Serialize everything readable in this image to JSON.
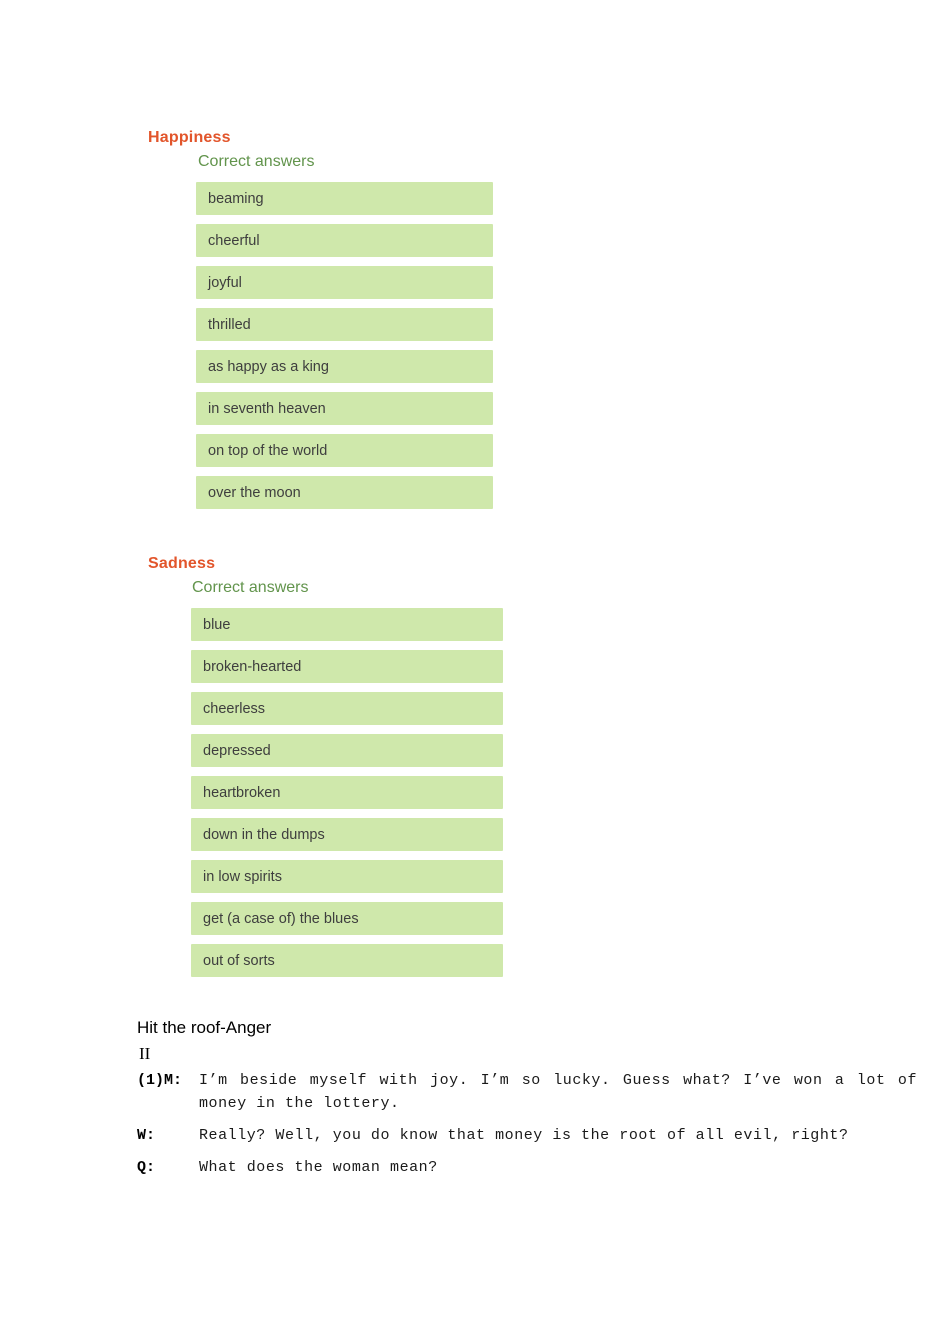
{
  "groups": [
    {
      "title": "Happiness",
      "correct_label": "Correct answers",
      "answers": [
        "beaming",
        "cheerful",
        "joyful",
        "thrilled",
        "as happy as a king",
        "in seventh heaven",
        "on top of the world",
        "over the moon"
      ]
    },
    {
      "title": "Sadness",
      "correct_label": "Correct answers",
      "answers": [
        "blue",
        "broken-hearted",
        "cheerless",
        "depressed",
        "heartbroken",
        "down in the dumps",
        "in low spirits",
        "get (a case of) the blues",
        "out of sorts"
      ]
    }
  ],
  "transcript": {
    "heading": "Hit the roof-Anger",
    "section_numeral": "II",
    "lines": [
      {
        "speaker": "(1)M:",
        "text": "I’m beside myself with joy. I’m so lucky. Guess what? I’ve won a lot of money in the lottery."
      },
      {
        "speaker": "W:",
        "text": "Really? Well, you do know that money is the root of all evil, right?"
      },
      {
        "speaker": "Q:",
        "text": "What does the woman mean?"
      }
    ]
  },
  "colors": {
    "title_orange": "#e2552b",
    "correct_green": "#62944c",
    "answer_bg": "#cfe8ab",
    "answer_text": "#3e3e3e",
    "page_bg": "#ffffff"
  }
}
